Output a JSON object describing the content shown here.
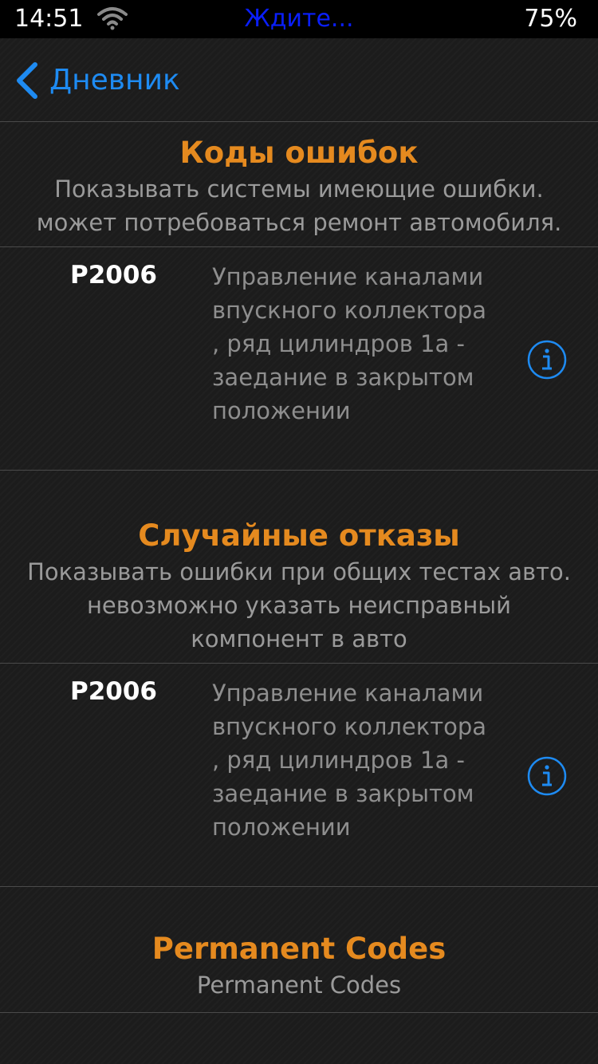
{
  "status_bar": {
    "time": "14:51",
    "center_text": "Ждите...",
    "battery": "75%",
    "wifi_icon": "wifi-icon"
  },
  "nav": {
    "back_label": "Дневник",
    "back_icon": "chevron-left-icon"
  },
  "sections": [
    {
      "title": "Коды ошибок",
      "description": "Показывать системы имеющие ошибки.\nможет потребоваться ремонт автомобиля.",
      "items": [
        {
          "code": "P2006",
          "description": "Управление каналами впускного коллектора , ряд цилиндров 1а - заедание в закрытом положении",
          "icon": "info-icon"
        }
      ]
    },
    {
      "title": "Случайные отказы",
      "description": "Показывать ошибки при общих тестах авто.\nневозможно указать неисправный\nкомпонент в авто",
      "items": [
        {
          "code": "P2006",
          "description": "Управление каналами впускного коллектора , ряд цилиндров 1а - заедание в закрытом положении",
          "icon": "info-icon"
        }
      ]
    },
    {
      "title": "Permanent Codes",
      "description": "Permanent Codes",
      "items": []
    }
  ],
  "colors": {
    "accent": "#1e8bf2",
    "section_title": "#e58a1f",
    "status_center": "#0a1fff"
  }
}
